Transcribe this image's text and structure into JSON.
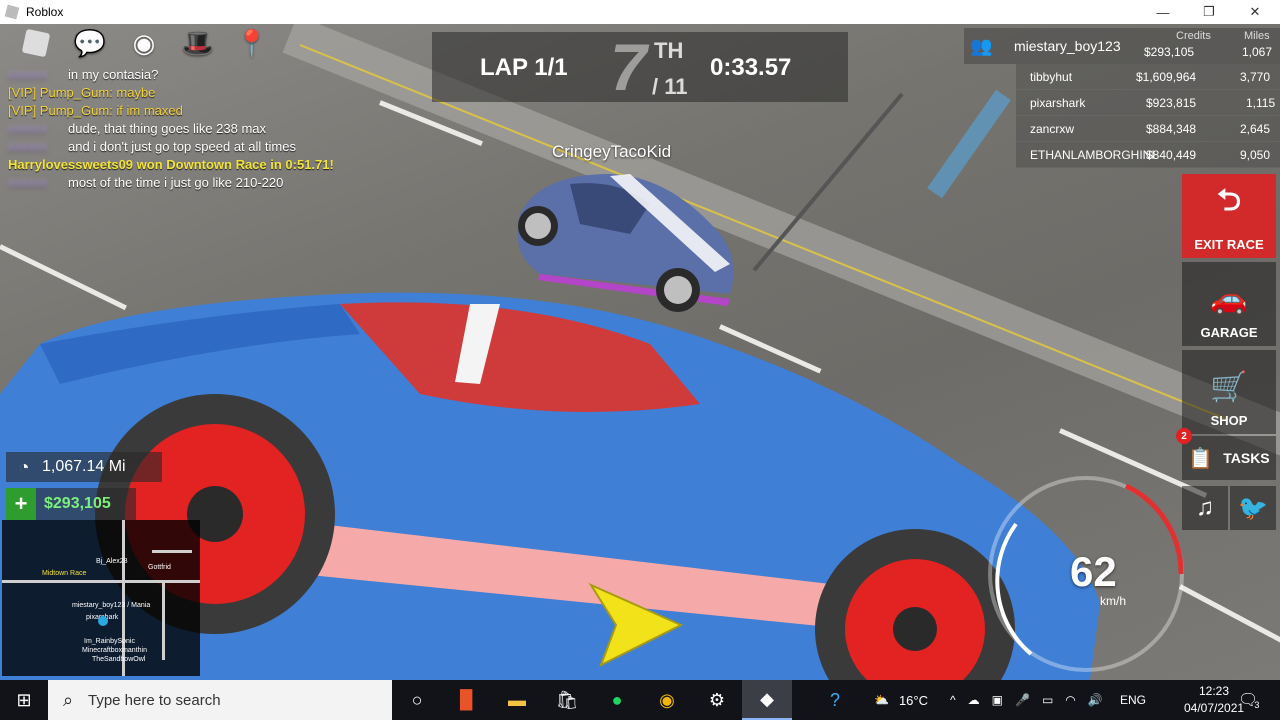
{
  "window": {
    "title": "Roblox",
    "minimize": "—",
    "restore": "❐",
    "close": "✕"
  },
  "top_icons": [
    "roblox-menu-icon",
    "chat-icon",
    "eye-icon",
    "player-hat-icon",
    "map-pin-icon"
  ],
  "chat": [
    {
      "who": "Hidden",
      "text": "in my contasia?",
      "kind": "hidden"
    },
    {
      "who": "[VIP] Pump_Gum:",
      "text": "maybe",
      "kind": "vip"
    },
    {
      "who": "[VIP] Pump_Gum:",
      "text": "if im maxed",
      "kind": "vip"
    },
    {
      "who": "Hidden",
      "text": "dude, that thing goes like 238 max",
      "kind": "hidden"
    },
    {
      "who": "Hidden",
      "text": "and i don't just go top speed at all times",
      "kind": "hidden"
    },
    {
      "who": "",
      "text": "Harrylovessweets09 won Downtown Race in 0:51.71!",
      "kind": "system"
    },
    {
      "who": "Hidden",
      "text": "most of the time i just go like 210-220",
      "kind": "hidden"
    }
  ],
  "race": {
    "lap": "LAP 1/1",
    "place": "7",
    "place_suffix": "TH",
    "place_total": "/ 11",
    "time": "0:33.57"
  },
  "opponent_name": "CringeyTacoKid",
  "leaderboard": {
    "me": {
      "name": "miestary_boy123",
      "credits_label": "Credits",
      "miles_label": "Miles",
      "credits": "$293,105",
      "miles": "1,067"
    },
    "rows": [
      {
        "name": "tibbyhut",
        "credits": "$1,609,964",
        "miles": "3,770"
      },
      {
        "name": "pixarshark",
        "credits": "$923,815",
        "miles": "1,115"
      },
      {
        "name": "zancrxw",
        "credits": "$884,348",
        "miles": "2,645"
      },
      {
        "name": "ETHANLAMBORGHINI",
        "credits": "$840,449",
        "miles": "9,050"
      }
    ]
  },
  "side_buttons": {
    "exit": "EXIT RACE",
    "garage": "GARAGE",
    "shop": "SHOP",
    "tasks": "TASKS",
    "tasks_badge": "2"
  },
  "hud": {
    "odometer": "1,067.14 Mi",
    "cash": "$293,105",
    "speed": "62",
    "speed_unit": "km/h",
    "rpm_fraction": 0.55
  },
  "minimap": {
    "labels": [
      "Midtown Race",
      "miestary_boy123 / Mania",
      "pixarshark",
      "Im_RainbySonic",
      "Minecraftboxmanthin",
      "TheSandbowOwl",
      "Gottfrid",
      "Bj_Alex28"
    ]
  },
  "taskbar": {
    "search_placeholder": "Type here to search",
    "weather": "16°C",
    "lang": "ENG",
    "time": "12:23",
    "date": "04/07/2021",
    "notif_count": "3"
  }
}
